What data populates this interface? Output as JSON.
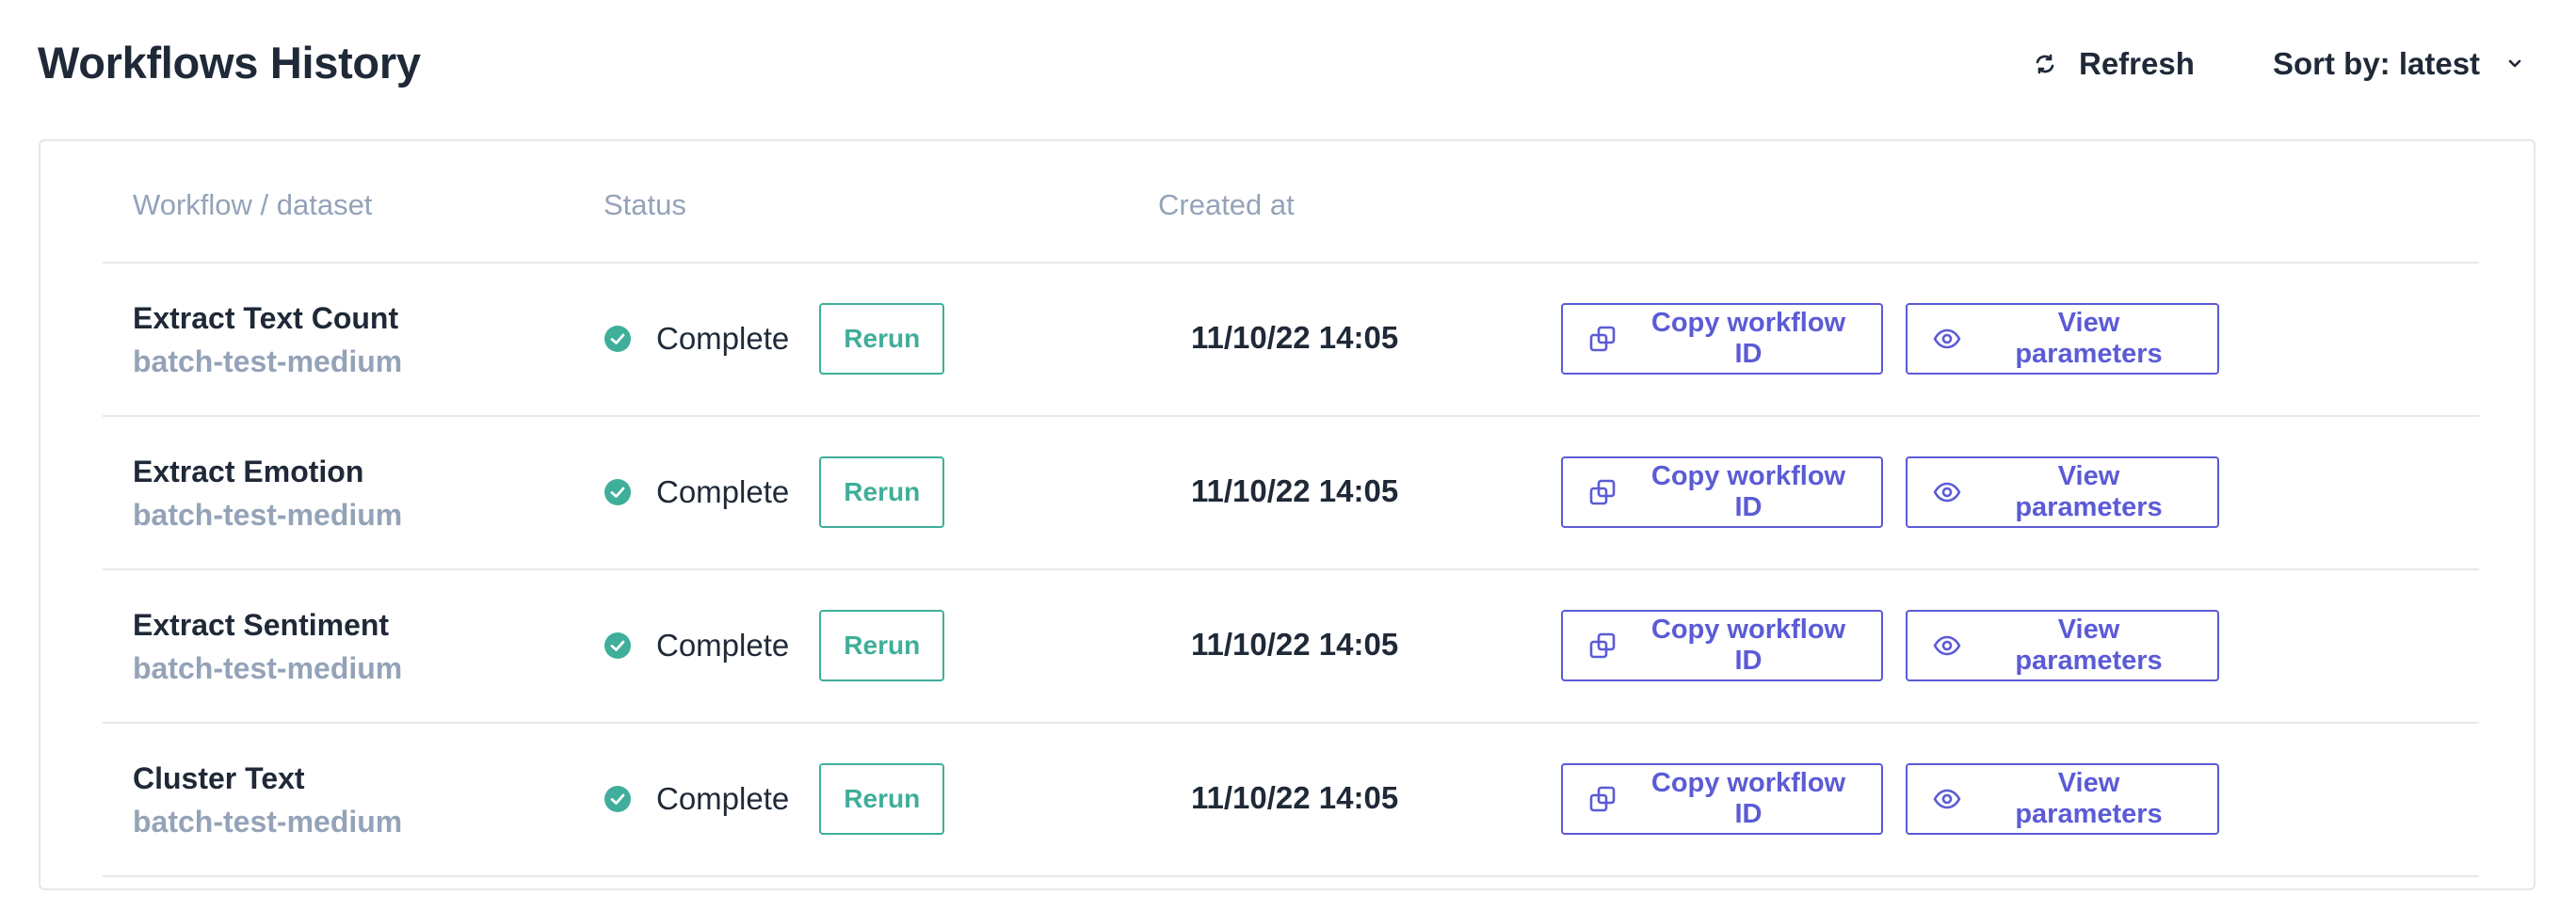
{
  "header": {
    "title": "Workflows History",
    "refresh_label": "Refresh",
    "sort_label": "Sort by: latest"
  },
  "table": {
    "columns": [
      "Workflow / dataset",
      "Status",
      "Created at"
    ],
    "rows": [
      {
        "workflow": "Extract Text Count",
        "dataset": "batch-test-medium",
        "status": "Complete",
        "rerun_label": "Rerun",
        "created_at": "11/10/22 14:05",
        "copy_label": "Copy workflow ID",
        "view_label": "View parameters"
      },
      {
        "workflow": "Extract Emotion",
        "dataset": "batch-test-medium",
        "status": "Complete",
        "rerun_label": "Rerun",
        "created_at": "11/10/22 14:05",
        "copy_label": "Copy workflow ID",
        "view_label": "View parameters"
      },
      {
        "workflow": "Extract Sentiment",
        "dataset": "batch-test-medium",
        "status": "Complete",
        "rerun_label": "Rerun",
        "created_at": "11/10/22 14:05",
        "copy_label": "Copy workflow ID",
        "view_label": "View parameters"
      },
      {
        "workflow": "Cluster Text",
        "dataset": "batch-test-medium",
        "status": "Complete",
        "rerun_label": "Rerun",
        "created_at": "11/10/22 14:05",
        "copy_label": "Copy workflow ID",
        "view_label": "View parameters"
      }
    ]
  },
  "icons": {
    "refresh": "refresh-icon",
    "sort": "chevron-down-icon",
    "status": "check-circle-icon",
    "copy": "copy-icon",
    "view": "eye-icon"
  },
  "colors": {
    "text": "#1f2937",
    "muted": "#94a3b8",
    "success": "#3fae9a",
    "accent": "#5b5bd6",
    "border": "#e5e7eb"
  }
}
